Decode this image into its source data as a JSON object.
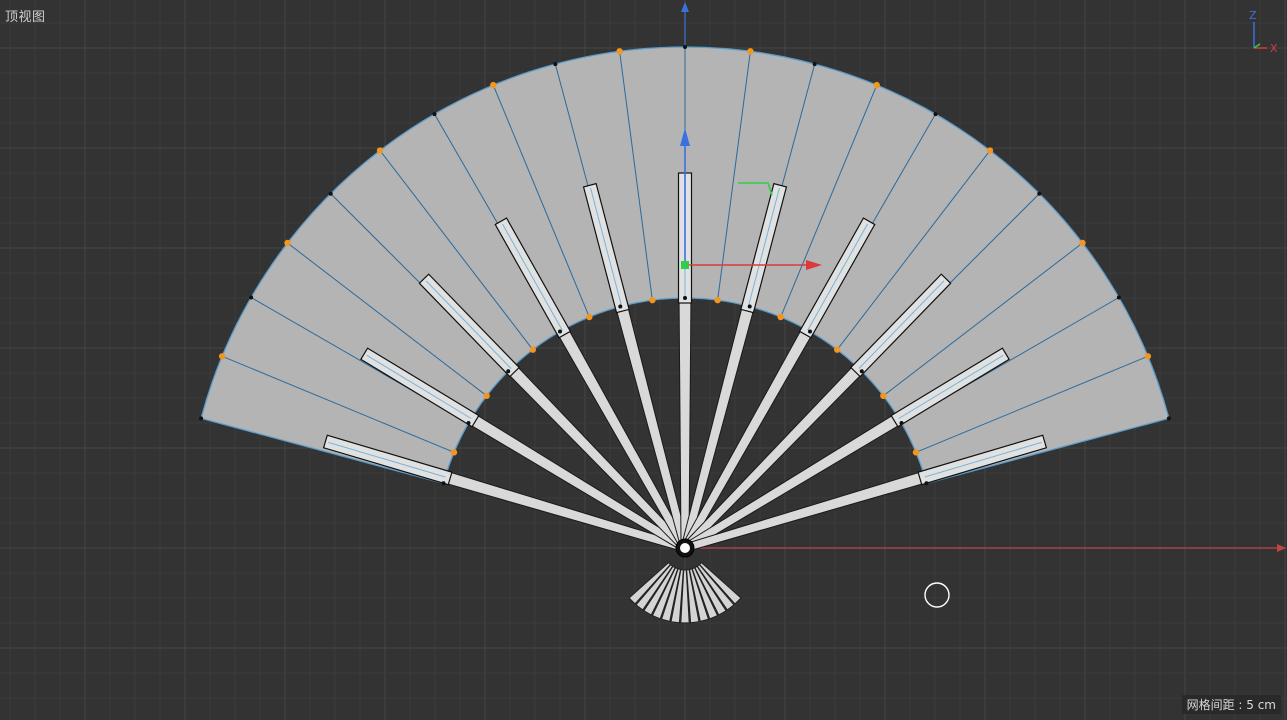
{
  "viewport": {
    "view_label": "顶视图",
    "grid_spacing": "网格间距 : 5 cm"
  },
  "gizmo": {
    "z_label": "Z",
    "x_label": "X"
  },
  "colors": {
    "background": "#333333",
    "grid_minor": "#3b3b3b",
    "grid_major": "#464646",
    "fan_fill": "#b4b4b4",
    "edge_line": "#2b6a9c",
    "outline": "#5a9ccc",
    "rib_fill": "#e0e2e2",
    "point_orange": "#f2961f",
    "point_black": "#111111",
    "axis_red": "#d93b3b",
    "axis_blue": "#3a70e0",
    "axis_green": "#2fcf4a"
  },
  "fan": {
    "spread_degrees": 150,
    "segments": 20,
    "ribs": 11
  }
}
